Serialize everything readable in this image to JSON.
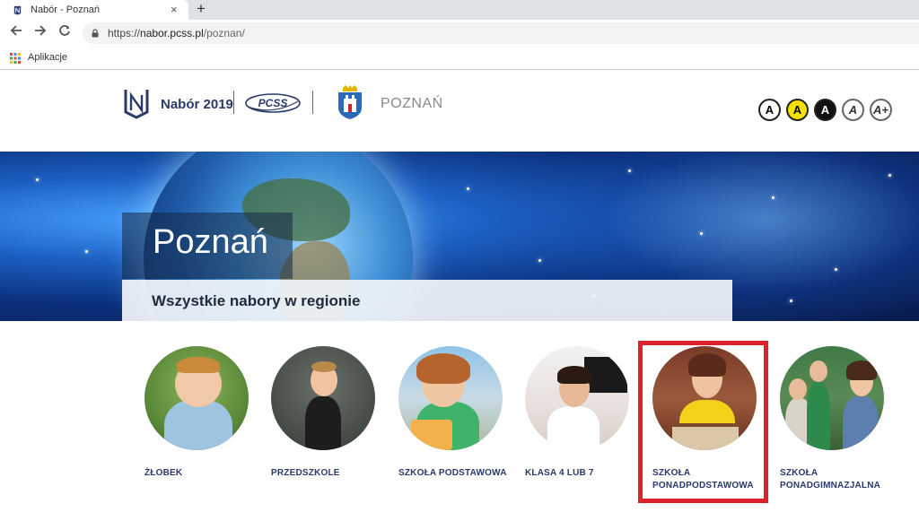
{
  "browser": {
    "tab_title": "Nabór - Poznań",
    "tab_close": "×",
    "new_tab": "+",
    "url_scheme": "https://",
    "url_host": "nabor.pcss.pl",
    "url_path": "/poznan/",
    "bookmark_apps": "Aplikacje"
  },
  "header": {
    "brand": "Nabór 2019",
    "city": "POZNAŃ",
    "accessibility": [
      {
        "label": "A"
      },
      {
        "label": "A"
      },
      {
        "label": "A"
      },
      {
        "label": "A"
      },
      {
        "label": "A+"
      }
    ]
  },
  "banner": {
    "title": "Poznań",
    "subtitle": "Wszystkie nabory w regionie"
  },
  "categories": [
    {
      "label": "ŻŁOBEK"
    },
    {
      "label": "PRZEDSZKOLE"
    },
    {
      "label": "SZKOŁA PODSTAWOWA"
    },
    {
      "label": "KLASA 4 LUB 7"
    },
    {
      "label": "SZKOŁA PONADPODSTAWOWA"
    },
    {
      "label": "SZKOŁA PONADGIMNAZJALNA"
    }
  ],
  "colors": {
    "brand_navy": "#2b3a6b",
    "highlight_red": "#e0202a",
    "contrast_yellow": "#f5e000"
  }
}
